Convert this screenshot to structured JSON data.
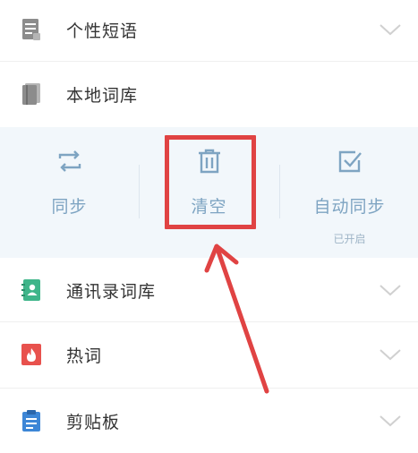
{
  "list": {
    "items": [
      {
        "label": "个性短语",
        "icon": "document-icon"
      },
      {
        "label": "本地词库",
        "icon": "book-icon"
      },
      {
        "label": "通讯录词库",
        "icon": "contacts-book-icon"
      },
      {
        "label": "热词",
        "icon": "flame-icon"
      },
      {
        "label": "剪贴板",
        "icon": "clipboard-icon"
      }
    ]
  },
  "panel": {
    "sync_label": "同步",
    "clear_label": "清空",
    "autosync_label": "自动同步",
    "autosync_status": "已开启"
  },
  "colors": {
    "accent": "#7ea4c2",
    "panel_bg": "#f2f7fb",
    "highlight": "#e04343",
    "contacts_icon": "#3fb58a",
    "flame_icon": "#e8514d",
    "clipboard_icon": "#3d86d6"
  }
}
